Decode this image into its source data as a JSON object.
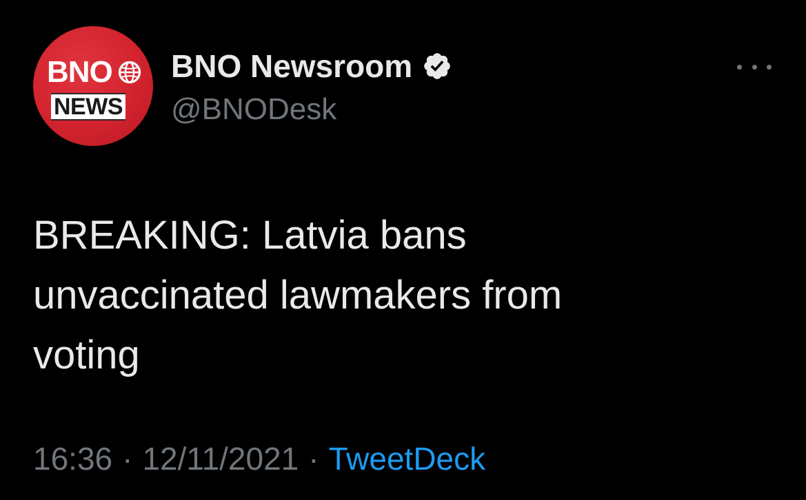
{
  "tweet": {
    "author": {
      "display_name": "BNO Newsroom",
      "handle": "@BNODesk",
      "verified": true,
      "avatar": {
        "logo_top": "BNO",
        "logo_bottom": "NEWS",
        "background_color": "#d2232e"
      }
    },
    "text": "BREAKING: Latvia bans\nunvaccinated lawmakers from\nvoting",
    "time": "16:36",
    "separator": "·",
    "date": "12/11/2021",
    "source": "TweetDeck",
    "more_icon": "more-horizontal-icon",
    "verified_icon": "verified-badge-icon"
  },
  "colors": {
    "background": "#000000",
    "primary_text": "#e7e9ea",
    "secondary_text": "#71767b",
    "link": "#1d9bf0"
  }
}
